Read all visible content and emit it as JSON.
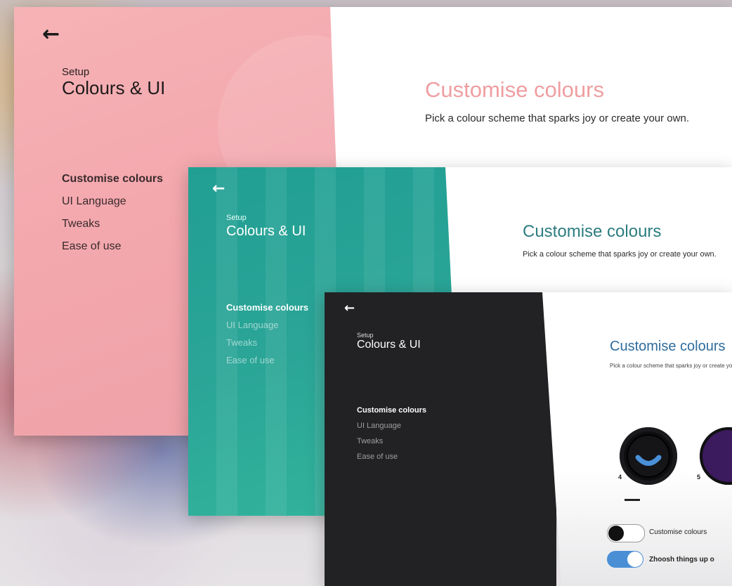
{
  "panels": [
    {
      "theme": "pink",
      "back": "←",
      "eyebrow": "Setup",
      "title": "Colours & UI",
      "nav": [
        "Customise colours",
        "UI Language",
        "Tweaks",
        "Ease of use"
      ],
      "active_index": 0,
      "content_title": "Customise colours",
      "content_desc": "Pick a colour scheme that sparks joy or create your own.",
      "accent": "#ef9ea1"
    },
    {
      "theme": "teal",
      "back": "←",
      "eyebrow": "Setup",
      "title": "Colours & UI",
      "nav": [
        "Customise colours",
        "UI Language",
        "Tweaks",
        "Ease of use"
      ],
      "active_index": 0,
      "content_title": "Customise colours",
      "content_desc": "Pick a colour scheme that sparks joy or create your own.",
      "accent": "#2d7d80"
    },
    {
      "theme": "dark",
      "back": "←",
      "eyebrow": "Setup",
      "title": "Colours & UI",
      "nav": [
        "Customise colours",
        "UI Language",
        "Tweaks",
        "Ease of use"
      ],
      "active_index": 0,
      "content_title": "Customise colours",
      "content_desc": "Pick a colour scheme that sparks joy or create your own.",
      "accent": "#2e6c9e",
      "swatches": [
        {
          "number": "4",
          "ring": "#111111",
          "smile": "#4a90d9"
        },
        {
          "number": "5",
          "fill": "#3b1a5e"
        }
      ],
      "toggles": [
        {
          "label": "Customise colours",
          "on": false
        },
        {
          "label": "Zhoosh things up o",
          "on": true
        }
      ]
    }
  ]
}
